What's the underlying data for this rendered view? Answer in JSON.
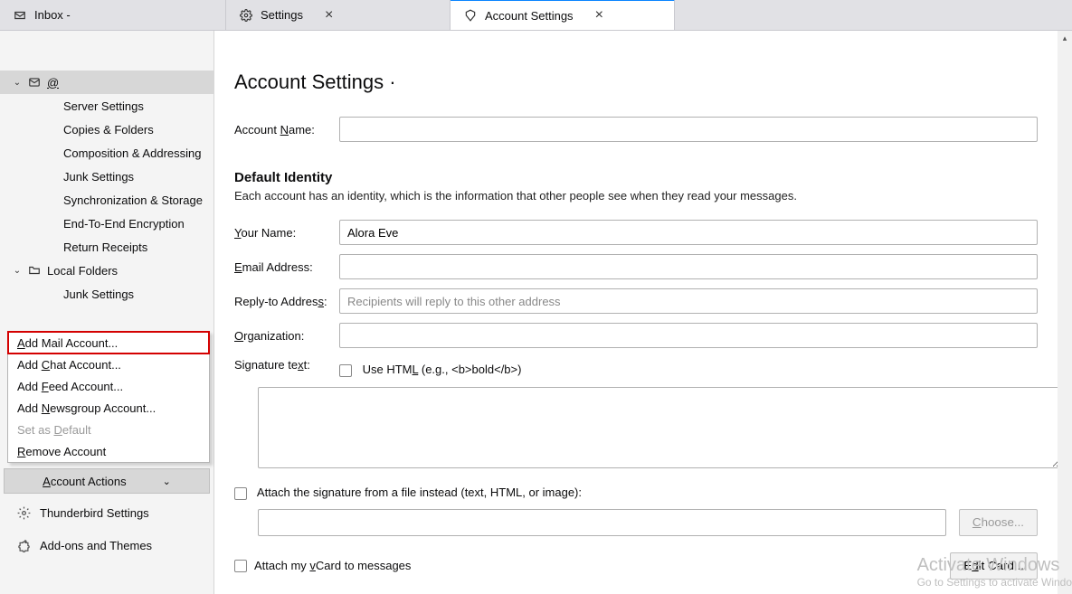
{
  "tabs": {
    "inbox": {
      "label": "Inbox -  "
    },
    "settings": {
      "label": "Settings"
    },
    "account": {
      "label": "Account Settings"
    }
  },
  "sidebar": {
    "account_email": "                @           ",
    "items": [
      "Server Settings",
      "Copies & Folders",
      "Composition & Addressing",
      "Junk Settings",
      "Synchronization & Storage",
      "End-To-End Encryption",
      "Return Receipts"
    ],
    "local_folders": "Local Folders",
    "local_junk": "Junk Settings",
    "account_actions": "Account Actions",
    "tb_settings": "Thunderbird Settings",
    "addons": "Add-ons and Themes"
  },
  "menu": {
    "add_mail": "Add Mail Account...",
    "add_chat": "Add Chat Account...",
    "add_feed": "Add Feed Account...",
    "add_news": "Add Newsgroup Account...",
    "set_default": "Set as Default",
    "remove": "Remove Account"
  },
  "content": {
    "title": "Account Settings ·",
    "account_name_label": "Account Name:",
    "account_name_value": "",
    "default_identity": "Default Identity",
    "identity_desc": "Each account has an identity, which is the information that other people see when they read your messages.",
    "your_name_label": "Your Name:",
    "your_name_value": "Alora Eve",
    "email_label": "Email Address:",
    "email_value": "",
    "reply_label": "Reply-to Address:",
    "reply_placeholder": "Recipients will reply to this other address",
    "org_label": "Organization:",
    "org_value": "",
    "sig_label": "Signature text:",
    "use_html": "Use HTML (e.g., <b>bold</b>)",
    "attach_file": "Attach the signature from a file instead (text, HTML, or image):",
    "choose": "Choose...",
    "attach_vcard": "Attach my vCard to messages",
    "edit_card": "Edit Card..."
  },
  "watermark": {
    "l1": "Activate Windows",
    "l2": "Go to Settings to activate Windo"
  }
}
